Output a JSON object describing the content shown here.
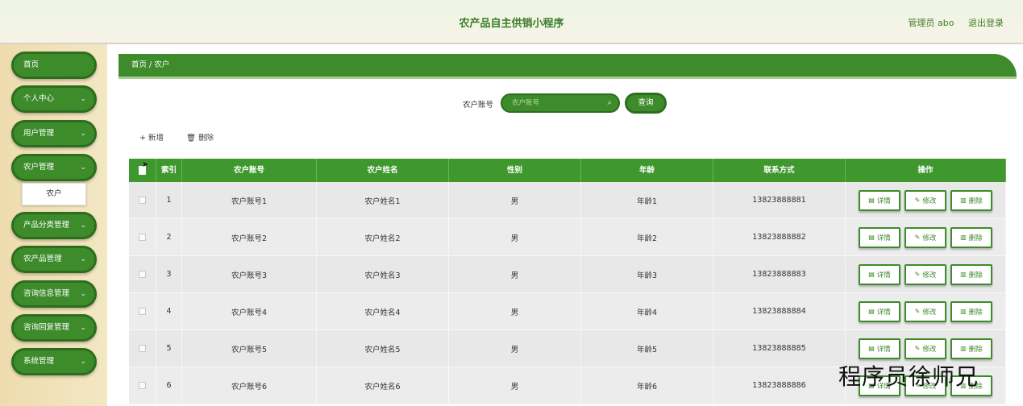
{
  "header": {
    "title": "农产品自主供销小程序",
    "user": "管理员 abo",
    "logout": "退出登录"
  },
  "sidebar": {
    "items": [
      {
        "label": "首页",
        "has_chevron": false
      },
      {
        "label": "个人中心",
        "has_chevron": true
      },
      {
        "label": "用户管理",
        "has_chevron": true
      },
      {
        "label": "农户管理",
        "has_chevron": true
      },
      {
        "label": "产品分类管理",
        "has_chevron": true
      },
      {
        "label": "农产品管理",
        "has_chevron": true
      },
      {
        "label": "咨询信息管理",
        "has_chevron": true
      },
      {
        "label": "咨询回复管理",
        "has_chevron": true
      },
      {
        "label": "系统管理",
        "has_chevron": true
      }
    ],
    "submenu_label": "农户"
  },
  "breadcrumb": "首页 / 农户",
  "search": {
    "label": "农户账号",
    "placeholder": "农户账号",
    "button": "查询"
  },
  "actions": {
    "add": "+ 新增",
    "delete": "删除"
  },
  "table": {
    "columns": [
      "索引",
      "农户账号",
      "农户姓名",
      "性别",
      "年龄",
      "联系方式",
      "操作"
    ],
    "rows": [
      {
        "index": "1",
        "account": "农户账号1",
        "name": "农户姓名1",
        "gender": "男",
        "age": "年龄1",
        "phone": "13823888881"
      },
      {
        "index": "2",
        "account": "农户账号2",
        "name": "农户姓名2",
        "gender": "男",
        "age": "年龄2",
        "phone": "13823888882"
      },
      {
        "index": "3",
        "account": "农户账号3",
        "name": "农户姓名3",
        "gender": "男",
        "age": "年龄3",
        "phone": "13823888883"
      },
      {
        "index": "4",
        "account": "农户账号4",
        "name": "农户姓名4",
        "gender": "男",
        "age": "年龄4",
        "phone": "13823888884"
      },
      {
        "index": "5",
        "account": "农户账号5",
        "name": "农户姓名5",
        "gender": "男",
        "age": "年龄5",
        "phone": "13823888885"
      },
      {
        "index": "6",
        "account": "农户账号6",
        "name": "农户姓名6",
        "gender": "男",
        "age": "年龄6",
        "phone": "13823888886"
      }
    ],
    "row_actions": {
      "detail": "详情",
      "edit": "修改",
      "delete": "删除"
    }
  },
  "watermark": "程序员徐师兄",
  "colors": {
    "primary": "#3d8b2b",
    "header_bg": "#eef5e4",
    "sidebar_bg": "#f0e2ba"
  }
}
